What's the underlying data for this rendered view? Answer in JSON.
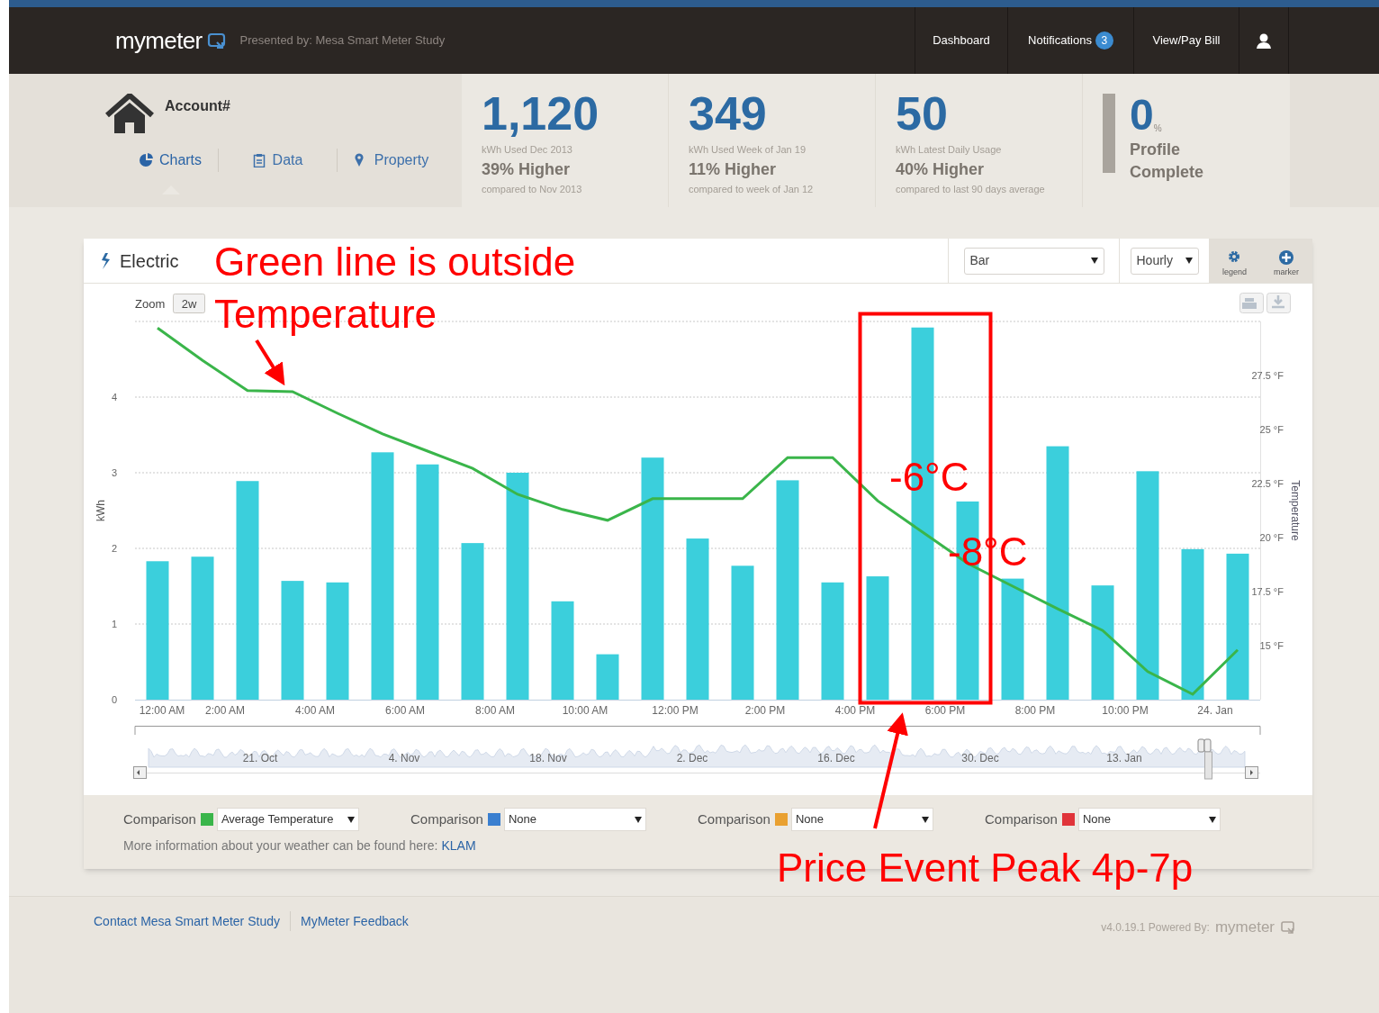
{
  "header": {
    "logo": "mymeter",
    "presented_by": "Presented by: Mesa Smart Meter Study",
    "nav": [
      {
        "label": "Dashboard"
      },
      {
        "label": "Notifications",
        "badge": "3"
      },
      {
        "label": "View/Pay Bill"
      }
    ]
  },
  "account": {
    "label": "Account#",
    "tabs": [
      {
        "label": "Charts",
        "selected": true
      },
      {
        "label": "Data",
        "selected": false
      },
      {
        "label": "Property",
        "selected": false
      }
    ]
  },
  "stats": [
    {
      "value": "1,120",
      "caption": "kWh Used Dec 2013",
      "change": "39% Higher",
      "compare": "compared to Nov 2013"
    },
    {
      "value": "349",
      "caption": "kWh Used Week of Jan 19",
      "change": "11% Higher",
      "compare": "compared to week of Jan 12"
    },
    {
      "value": "50",
      "caption": "kWh Latest Daily Usage",
      "change": "40% Higher",
      "compare": "compared to last 90 days average"
    }
  ],
  "profile": {
    "value": "0",
    "unit": "%",
    "label": "Profile Complete",
    "level": 0
  },
  "chart_card": {
    "title": "Electric",
    "chart_type": "Bar",
    "interval": "Hourly",
    "tools": [
      {
        "label": "legend"
      },
      {
        "label": "marker"
      }
    ],
    "zoom_label": "Zoom",
    "zoom_button": "2w",
    "chart_data": {
      "type": "bar",
      "categories": [
        "12:00 AM",
        "2:00 AM",
        null,
        "4:00 AM",
        null,
        "6:00 AM",
        null,
        "8:00 AM",
        null,
        "10:00 AM",
        null,
        "12:00 PM",
        null,
        "2:00 PM",
        null,
        "4:00 PM",
        null,
        "6:00 PM",
        null,
        "8:00 PM",
        null,
        "10:00 PM",
        null,
        "24. Jan",
        null
      ],
      "series": [
        {
          "name": "kWh",
          "color": "#3bcfdc",
          "values": [
            1.83,
            1.89,
            2.89,
            1.57,
            1.55,
            3.27,
            3.11,
            2.07,
            3.0,
            1.3,
            0.6,
            3.2,
            2.13,
            1.77,
            2.9,
            1.55,
            1.63,
            4.92,
            2.62,
            1.6,
            3.35,
            1.51,
            3.02,
            1.99,
            1.93
          ]
        }
      ],
      "ylim": [
        0,
        5
      ],
      "yticks": [
        0,
        1,
        2,
        3,
        4
      ],
      "grid": true
    },
    "temperature_chart": {
      "chart_data": {
        "type": "line",
        "categories": [
          null,
          null,
          null,
          null,
          null,
          null,
          null,
          null,
          null,
          null,
          null,
          null,
          null,
          null,
          null,
          null,
          null,
          null,
          null,
          null,
          null,
          null,
          null,
          null,
          null
        ],
        "series": [
          {
            "name": "Temperature",
            "color": "#3ab54a",
            "values": [
              29.7,
              28.2,
              26.8,
              26.75,
              25.75,
              24.8,
              24.0,
              23.2,
              22.0,
              21.3,
              20.8,
              21.8,
              21.8,
              21.8,
              23.7,
              23.7,
              21.7,
              20.25,
              18.8,
              17.75,
              16.7,
              15.7,
              13.8,
              12.75,
              14.8
            ]
          }
        ],
        "ylim": [
          12.5,
          30
        ],
        "yticks": [
          {
            "value": 27.5,
            "label": "27.5 °F"
          },
          {
            "value": 25,
            "label": "25 °F"
          },
          {
            "value": 22.5,
            "label": "22.5 °F"
          },
          {
            "value": 20,
            "label": "20 °F"
          },
          {
            "value": 17.5,
            "label": "17.5 °F"
          },
          {
            "value": 15,
            "label": "15 °F"
          }
        ]
      }
    },
    "navigator_dates": [
      "21. Oct",
      "4. Nov",
      "18. Nov",
      "2. Dec",
      "16. Dec",
      "30. Dec",
      "13. Jan"
    ],
    "comparisons": [
      {
        "label": "Comparison",
        "color": "#3ab54a",
        "value": "Average Temperature"
      },
      {
        "label": "Comparison",
        "color": "#3a7fd0",
        "value": "None"
      },
      {
        "label": "Comparison",
        "color": "#e9a030",
        "value": "None"
      },
      {
        "label": "Comparison",
        "color": "#e0343a",
        "value": "None"
      }
    ],
    "weather_note": "More information about your weather can be found here:",
    "weather_link": "KLAM"
  },
  "footer": {
    "links": [
      "Contact Mesa Smart Meter Study",
      "MyMeter Feedback"
    ],
    "version": "v4.0.19.1 Powered By:",
    "logo": "mymeter"
  },
  "annotations": [
    {
      "kind": "text",
      "text": "Green line is outside"
    },
    {
      "kind": "text",
      "text": "Temperature"
    },
    {
      "kind": "arrow"
    },
    {
      "kind": "box"
    },
    {
      "kind": "text",
      "text": "-6°C"
    },
    {
      "kind": "text",
      "text": "-8°C"
    },
    {
      "kind": "arrow"
    },
    {
      "kind": "text",
      "text": "Price Event Peak 4p-7p"
    }
  ]
}
